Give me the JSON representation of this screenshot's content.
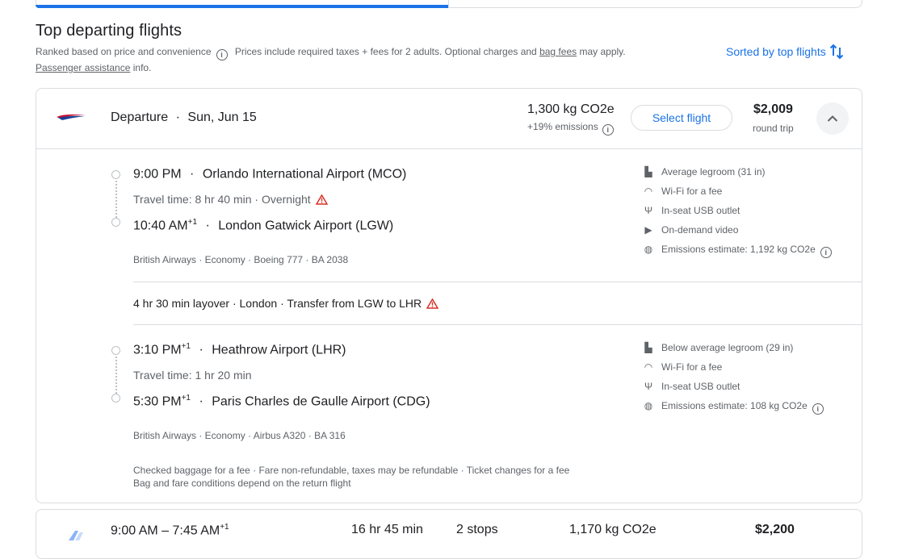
{
  "colors": {
    "accent": "#1a73e8",
    "muted": "#5f6368",
    "border": "#dadce0",
    "warning": "#d93025"
  },
  "section": {
    "title": "Top departing flights",
    "ranked": "Ranked based on price and convenience",
    "prices_note_a": "Prices include required taxes + fees for 2 adults. Optional charges and",
    "bag_fees": "bag fees",
    "prices_note_b": "may apply.",
    "passenger_assistance": "Passenger assistance",
    "info": "info.",
    "sorted_label": "Sorted by top flights"
  },
  "flight1": {
    "airline_logo": "british-airways-logo",
    "departure_label": "Departure",
    "date": "Sun, Jun 15",
    "co2": "1,300 kg CO2e",
    "emissions_delta": "+19% emissions",
    "select_label": "Select flight",
    "price": "$2,009",
    "price_type": "round trip",
    "segments": [
      {
        "dep_time": "9:00 PM",
        "dep_sup": "",
        "dep_airport": "Orlando International Airport (MCO)",
        "travel_time": "Travel time: 8 hr 40 min · Overnight",
        "arr_time": "10:40 AM",
        "arr_sup": "+1",
        "arr_airport": "London Gatwick Airport (LGW)",
        "details": "British Airways · Economy · Boeing 777 · BA 2038",
        "amenities": [
          {
            "icon": "legroom-icon",
            "label": "Average legroom (31 in)"
          },
          {
            "icon": "wifi-icon",
            "label": "Wi-Fi for a fee"
          },
          {
            "icon": "usb-icon",
            "label": "In-seat USB outlet"
          },
          {
            "icon": "video-icon",
            "label": "On-demand video"
          },
          {
            "icon": "globe-icon",
            "label": "Emissions estimate: 1,192 kg CO2e"
          }
        ]
      },
      {
        "dep_time": "3:10 PM",
        "dep_sup": "+1",
        "dep_airport": "Heathrow Airport (LHR)",
        "travel_time": "Travel time: 1 hr 20 min",
        "arr_time": "5:30 PM",
        "arr_sup": "+1",
        "arr_airport": "Paris Charles de Gaulle Airport (CDG)",
        "details": "British Airways · Economy · Airbus A320 · BA 316",
        "amenities": [
          {
            "icon": "legroom-icon",
            "label": "Below average legroom (29 in)"
          },
          {
            "icon": "wifi-icon",
            "label": "Wi-Fi for a fee"
          },
          {
            "icon": "usb-icon",
            "label": "In-seat USB outlet"
          },
          {
            "icon": "globe-icon",
            "label": "Emissions estimate: 108 kg CO2e"
          }
        ]
      }
    ],
    "layover": "4 hr 30 min layover · London · Transfer from LGW to LHR",
    "baggage_line1": "Checked baggage for a fee · Fare non-refundable, taxes may be refundable · Ticket changes for a fee",
    "baggage_line2": "Bag and fare conditions depend on the return flight"
  },
  "flight2": {
    "times": "9:00 AM – 7:45 AM",
    "times_sup": "+1",
    "duration": "16 hr 45 min",
    "stops": "2 stops",
    "co2": "1,170 kg CO2e",
    "price": "$2,200"
  }
}
